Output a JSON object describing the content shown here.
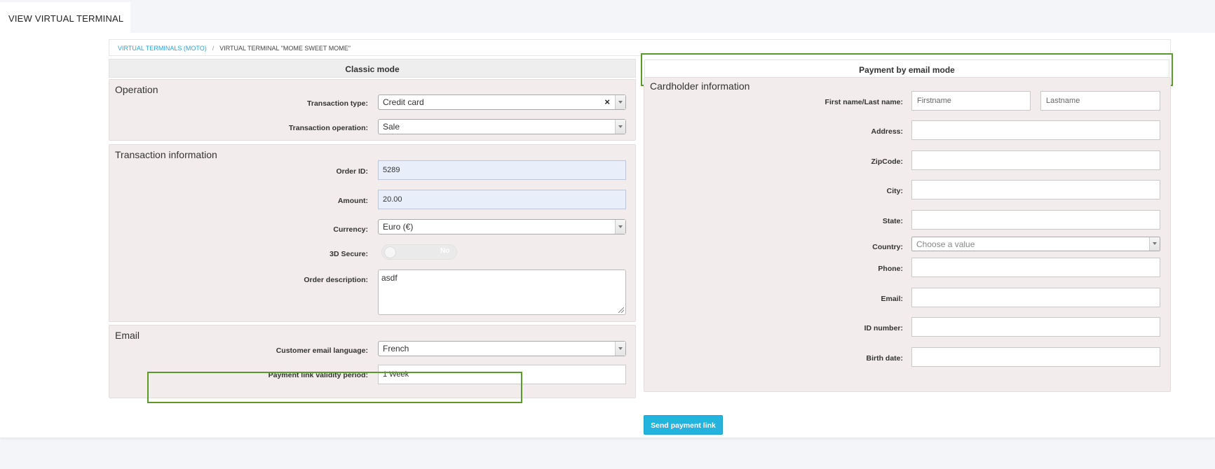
{
  "page_tab": "VIEW VIRTUAL TERMINAL",
  "breadcrumb": {
    "link": "VIRTUAL TERMINALS (MOTO)",
    "separator": "/",
    "current": "VIRTUAL TERMINAL \"MOME SWEET MOME\""
  },
  "modes": {
    "classic": "Classic mode",
    "email": "Payment by email mode"
  },
  "operation": {
    "title": "Operation",
    "transaction_type_label": "Transaction type:",
    "transaction_type_value": "Credit card",
    "transaction_operation_label": "Transaction operation:",
    "transaction_operation_value": "Sale"
  },
  "transaction_info": {
    "title": "Transaction information",
    "order_id_label": "Order ID:",
    "order_id_value": "5289",
    "amount_label": "Amount:",
    "amount_value": "20.00",
    "currency_label": "Currency:",
    "currency_value": "Euro (€)",
    "secure_label": "3D Secure:",
    "secure_value": "No",
    "description_label": "Order description:",
    "description_value": "asdf"
  },
  "email": {
    "title": "Email",
    "language_label": "Customer email language:",
    "language_value": "French",
    "validity_label": "Payment link validity period:",
    "validity_value": "1 Week"
  },
  "cardholder": {
    "title": "Cardholder information",
    "name_label": "First name/Last name:",
    "firstname_placeholder": "Firstname",
    "lastname_placeholder": "Lastname",
    "address_label": "Address:",
    "zipcode_label": "ZipCode:",
    "city_label": "City:",
    "state_label": "State:",
    "country_label": "Country:",
    "country_placeholder": "Choose a value",
    "phone_label": "Phone:",
    "email_label": "Email:",
    "id_label": "ID number:",
    "birth_label": "Birth date:"
  },
  "send_button": "Send payment link",
  "colors": {
    "accent": "#24b3dc",
    "highlight": "#5a9a2a",
    "panel_bg": "#f3ecec"
  }
}
